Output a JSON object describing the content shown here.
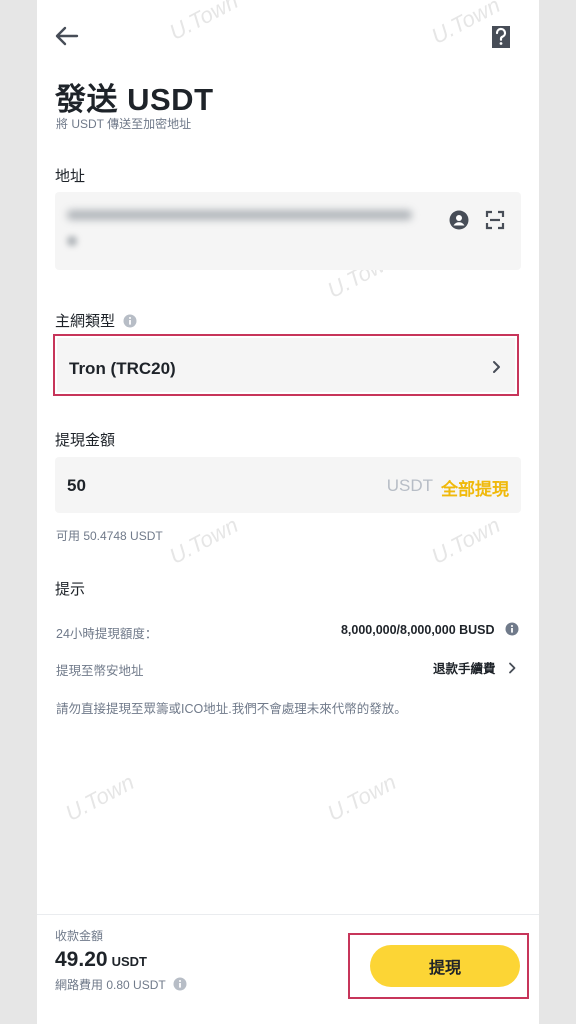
{
  "header": {
    "title": "發送 USDT",
    "subtitle": "將 USDT 傳送至加密地址"
  },
  "address": {
    "label": "地址"
  },
  "network": {
    "label": "主網類型",
    "value": "Tron (TRC20)"
  },
  "amount": {
    "label": "提現金額",
    "value": "50",
    "unit": "USDT",
    "max_label": "全部提現",
    "available": "可用  50.4748 USDT"
  },
  "tips": {
    "title": "提示",
    "limit_label": "24小時提現額度：",
    "limit_value": "8,000,000/8,000,000 BUSD",
    "binance_label": "提現至幣安地址",
    "binance_value": "退款手續費",
    "warning": "請勿直接提現至眾籌或ICO地址.我們不會處理未來代幣的發放。"
  },
  "footer": {
    "receive_label": "收款金額",
    "receive_amount": "49.20",
    "receive_unit": "USDT",
    "network_fee": "網路費用 0.80 USDT",
    "withdraw_label": "提現"
  },
  "watermark": "U.Town",
  "colors": {
    "accent": "#f0b90b",
    "button": "#fcd535",
    "highlight": "#c7355a",
    "field_bg": "#f5f5f5"
  }
}
